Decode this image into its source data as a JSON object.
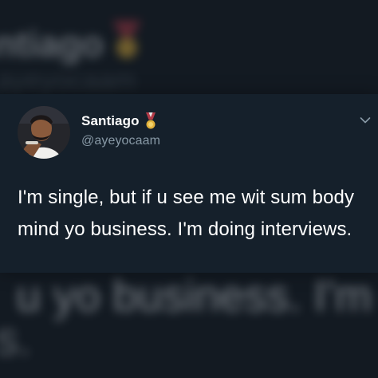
{
  "background": {
    "blurred_name": "ntiago",
    "blurred_handle": "ayeyocaam",
    "blurred_line": "u yo business. I'm doing",
    "blurred_tail": "s."
  },
  "tweet": {
    "display_name": "Santiago",
    "handle": "@ayeyocaam",
    "badge_icon": "medal-icon",
    "text": "I'm single, but if u see me wit sum body mind yo business. I'm doing interviews."
  },
  "menu": {
    "icon": "chevron-down-icon"
  },
  "colors": {
    "background": "#15202b",
    "text": "#ffffff",
    "secondary_text": "#8899a6",
    "medal_ribbon": "#b23a48",
    "medal_gold": "#e2b13b"
  }
}
